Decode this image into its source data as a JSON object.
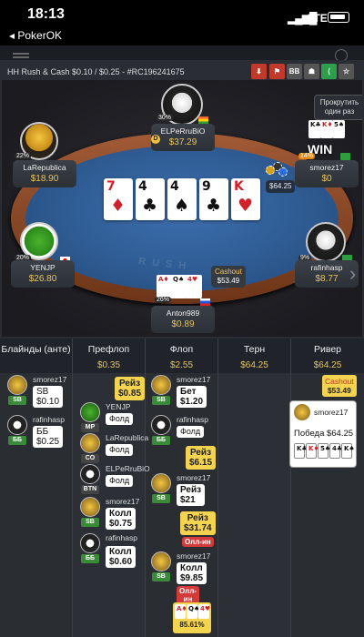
{
  "status_bar": {
    "time": "18:13",
    "back": "◂ PokerOK",
    "network": "LTE"
  },
  "hand": {
    "title": "HH Rush & Cash $0.10 / $0.25 - #RC196241675",
    "toolbar_icons": [
      "download-icon",
      "flag-icon",
      "bb-icon",
      "spy-icon",
      "share-icon",
      "star-icon"
    ],
    "toolbar_bb_label": "BB",
    "scroll_hint": "Прокрутить один раз",
    "board": [
      {
        "rank": "7",
        "suit": "♦",
        "color": "red"
      },
      {
        "rank": "4",
        "suit": "♣",
        "color": "black"
      },
      {
        "rank": "4",
        "suit": "♠",
        "color": "black"
      },
      {
        "rank": "9",
        "suit": "♣",
        "color": "black"
      },
      {
        "rank": "K",
        "suit": "♥",
        "color": "red"
      }
    ],
    "pot_chip": "$64.25",
    "felt_letters": "R U S H"
  },
  "players": [
    {
      "id": "elperrubio",
      "name": "ELPeRruBiO",
      "stack": "$37.29",
      "pct": "30%",
      "badge": "D"
    },
    {
      "id": "larepublica",
      "name": "LaRepublica",
      "stack": "$18.90",
      "pct": "22%"
    },
    {
      "id": "smorez17",
      "name": "smorez17",
      "stack": "$0",
      "pct": "14%",
      "win_label": "WIN",
      "cards": [
        "K♣",
        "K♦",
        "5♠"
      ]
    },
    {
      "id": "yenjp",
      "name": "YENJP",
      "stack": "$26.80",
      "pct": "20%"
    },
    {
      "id": "rafinhasp",
      "name": "rafinhasp",
      "stack": "$8.77",
      "pct": "9%"
    },
    {
      "id": "anton989",
      "name": "Anton989",
      "stack": "$0.89",
      "pct": "26%",
      "cards": [
        "A♦",
        "Q♠",
        "4♥"
      ]
    }
  ],
  "cashout": {
    "label": "Cashout",
    "value": "$53.49"
  },
  "streets": [
    {
      "label": "Блайнды (анте)",
      "value": ""
    },
    {
      "label": "Префлоп",
      "value": "$0.35"
    },
    {
      "label": "Флоп",
      "value": "$2.55"
    },
    {
      "label": "Терн",
      "value": "$64.25"
    },
    {
      "label": "Ривер",
      "value": "$64.25"
    }
  ],
  "blinds_actions": [
    {
      "name": "smorez17",
      "tag": "SB",
      "action": "SB\n$0.10"
    },
    {
      "name": "rafinhasp",
      "tag": "ББ",
      "action": "ББ\n$0.25"
    }
  ],
  "preflop_actions": [
    {
      "raise": "Рейз\n$0.85"
    },
    {
      "name": "YENJP",
      "tag": "MP",
      "action": "Фолд"
    },
    {
      "name": "LaRepublica",
      "tag": "CO",
      "action": "Фолд"
    },
    {
      "name": "ELPeRruBiO",
      "tag": "BTN",
      "action": "Фолд"
    },
    {
      "name": "smorez17",
      "tag": "SB",
      "action": "Колл\n$0.75"
    },
    {
      "name": "rafinhasp",
      "tag": "ББ",
      "action": "Колл\n$0.60"
    }
  ],
  "flop_actions": [
    {
      "name": "smorez17",
      "tag": "SB",
      "action": "Бет\n$1.20"
    },
    {
      "name": "rafinhasp",
      "tag": "ББ",
      "action": "Фолд"
    },
    {
      "raise": "Рейз\n$6.15"
    },
    {
      "name": "smorez17",
      "tag": "SB",
      "action": "Рейз\n$21"
    },
    {
      "raise": "Рейз\n$31.74",
      "allin": "Олл-ин"
    },
    {
      "name": "smorez17",
      "tag": "SB",
      "action": "Колл\n$9.85",
      "allin": "Олл-ин"
    }
  ],
  "flop_equity": {
    "cards": [
      "A♦",
      "Q♠",
      "4♥"
    ],
    "value": "85.61%"
  },
  "river": {
    "cashout_label": "Cashout",
    "cashout_value": "$53.49",
    "winner": "smorez17",
    "win_text": "Победа $64.25",
    "cards": [
      "K♣",
      "K♦",
      "5♠",
      "4♣",
      "K♠"
    ]
  }
}
